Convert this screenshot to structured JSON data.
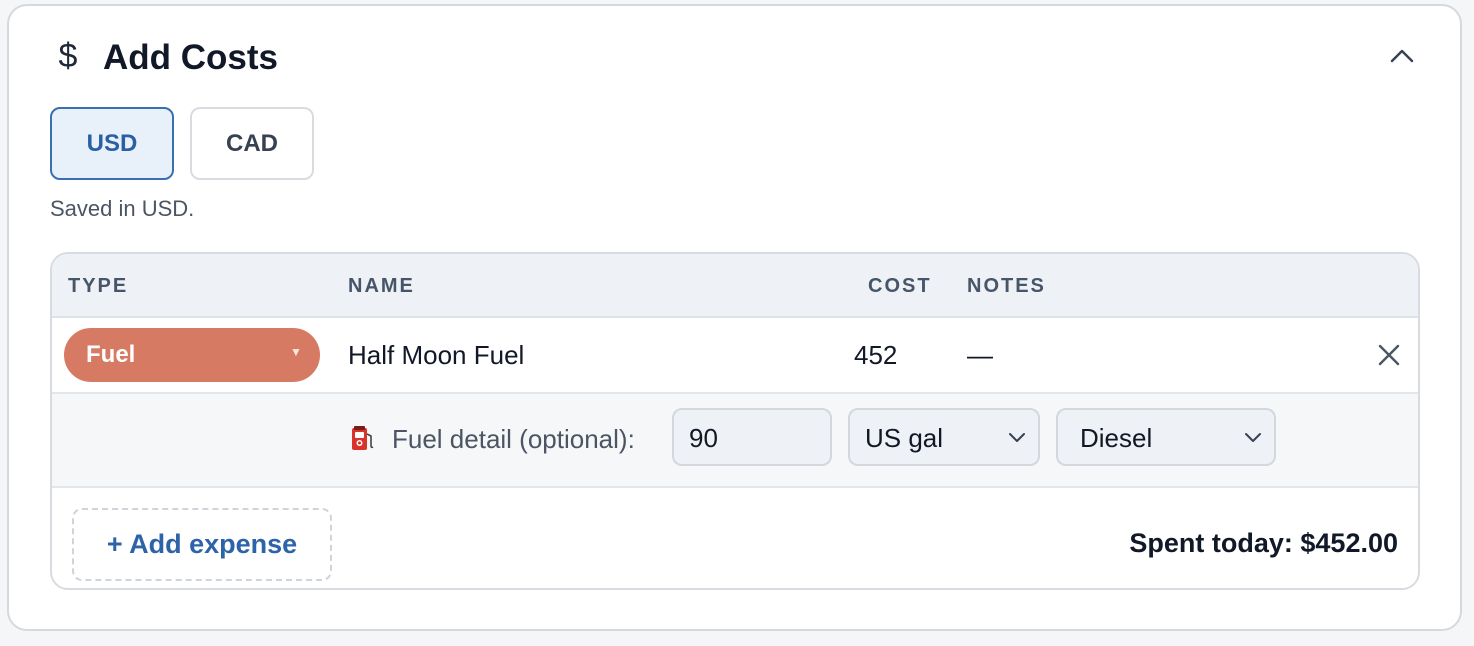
{
  "header": {
    "icon": "dollar-icon",
    "currency_symbol": "$",
    "title": "Add Costs",
    "collapse_icon": "chevron-up-icon"
  },
  "currency": {
    "options": [
      "USD",
      "CAD"
    ],
    "selected": "USD",
    "saved_note": "Saved in USD."
  },
  "table": {
    "columns": {
      "type": "TYPE",
      "name": "NAME",
      "cost": "COST",
      "notes": "NOTES"
    },
    "rows": [
      {
        "type": "Fuel",
        "name": "Half Moon Fuel",
        "cost": "452",
        "notes": "—",
        "fuel_detail": {
          "label": "Fuel detail (optional):",
          "quantity": "90",
          "unit": "US gal",
          "fuel_type": "Diesel"
        }
      }
    ]
  },
  "footer": {
    "add_label": "+ Add expense",
    "spent_label": "Spent today: $452.00"
  },
  "colors": {
    "accent": "#2a5fa5",
    "fuel_pill": "#d77a63",
    "header_bg": "#eef1f5"
  }
}
